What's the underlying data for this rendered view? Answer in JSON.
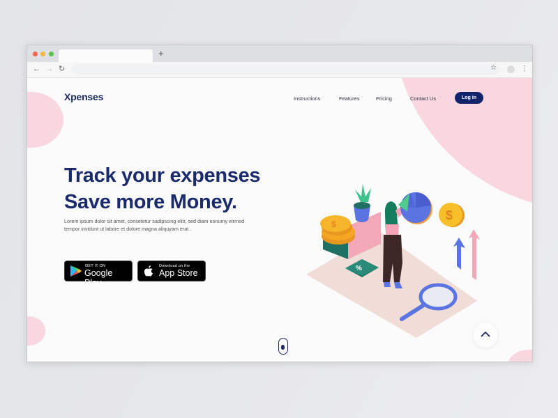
{
  "browser": {
    "new_tab_label": "+",
    "icons": {
      "back": "arrow-left-icon",
      "forward": "arrow-right-icon",
      "reload": "reload-icon",
      "bookmark": "star-icon",
      "profile": "avatar-icon",
      "menu": "kebab-menu-icon"
    },
    "url": ""
  },
  "header": {
    "logo": "Xpenses",
    "nav": [
      "Instructions",
      "Features",
      "Pricing",
      "Contact Us"
    ],
    "login_label": "Log in"
  },
  "hero": {
    "headline_line1": "Track your expenses",
    "headline_line2": "Save more Money.",
    "description": "Lorem ipsum dolor sit amet, consetetur sadipscing elitr, sed diam nonumy eirmod tempor invidunt ut labore et dolore magna aliquyam erat .",
    "google_play": {
      "small": "GET IT ON",
      "big": "Google Play"
    },
    "app_store": {
      "small": "Download on the",
      "big": "App Store"
    }
  },
  "illustration": {
    "description": "Isometric finance illustration: woman touching pie chart, coins, plant, percent tile, magnifier, upward arrows",
    "percent_symbol": "%",
    "coin_symbol": "$"
  },
  "colors": {
    "brand_navy": "#13256a",
    "blob_pink": "#f8d7e0",
    "teal": "#1f6f63",
    "coin": "#f7b52b",
    "blue": "#5b74e0"
  }
}
